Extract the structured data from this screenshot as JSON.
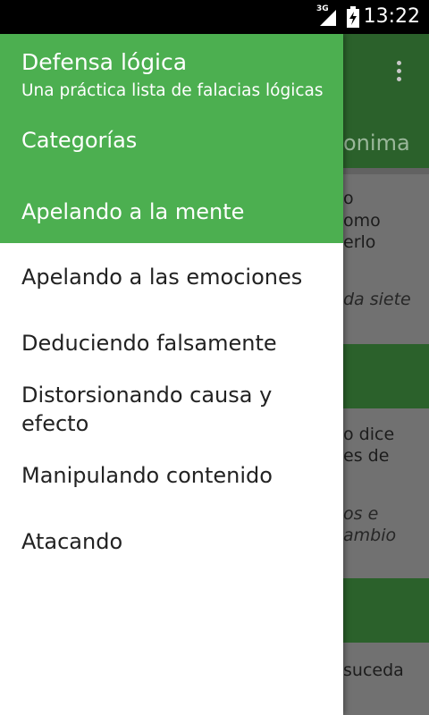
{
  "status_bar": {
    "network": "3G",
    "time": "13:22"
  },
  "background": {
    "tab_label": "onima",
    "card1_lines": [
      "o",
      "omo",
      "erlo"
    ],
    "card1_italic": "da siete",
    "card2_lines": [
      "o dice",
      "es de"
    ],
    "card2_italic_lines": [
      "os e",
      "ambio"
    ],
    "card3_line": "suceda"
  },
  "drawer": {
    "title": "Defensa lógica",
    "subtitle": "Una práctica lista de falacias lógicas",
    "section": "Categorías",
    "items": [
      {
        "label": "Apelando a la mente",
        "active": true
      },
      {
        "label": "Apelando a las emociones",
        "active": false
      },
      {
        "label": "Deduciendo falsamente",
        "active": false
      },
      {
        "label": "Distorsionando causa y\nefecto",
        "active": false
      },
      {
        "label": "Manipulando contenido",
        "active": false
      },
      {
        "label": "Atacando",
        "active": false
      }
    ]
  },
  "colors": {
    "accent": "#4caf50",
    "app_bar_dimmed": "#2f6a2f",
    "status_bar": "#000000"
  },
  "icons": {
    "overflow": "more-vert-icon",
    "signal": "signal-icon",
    "battery": "battery-charging-icon"
  }
}
